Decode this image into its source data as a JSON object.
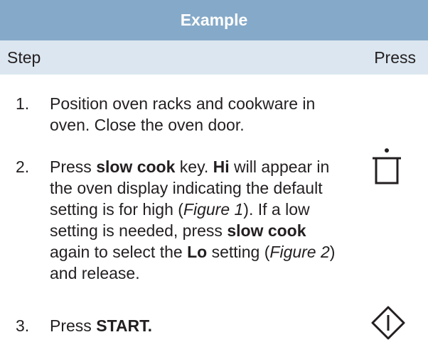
{
  "header": {
    "title": "Example"
  },
  "columns": {
    "step": "Step",
    "press": "Press"
  },
  "steps": [
    {
      "number": "1.",
      "text": "Position oven racks and cookware in oven. Close the oven door."
    },
    {
      "number": "2.",
      "parts": {
        "a": "Press ",
        "b": "slow cook",
        "c": " key. ",
        "d": "Hi",
        "e": " will appear in the oven display indicating the default setting is for high (",
        "f": "Figure 1",
        "g": "). If a low setting is needed, press ",
        "h": "slow cook",
        "i": " again to select the ",
        "j": "Lo",
        "k": " setting (",
        "l": "Figure 2",
        "m": ") and release."
      },
      "icon": "slow-cook-pot-icon"
    },
    {
      "number": "3.",
      "parts": {
        "a": "Press ",
        "b": "START."
      },
      "icon": "start-diamond-icon"
    }
  ]
}
